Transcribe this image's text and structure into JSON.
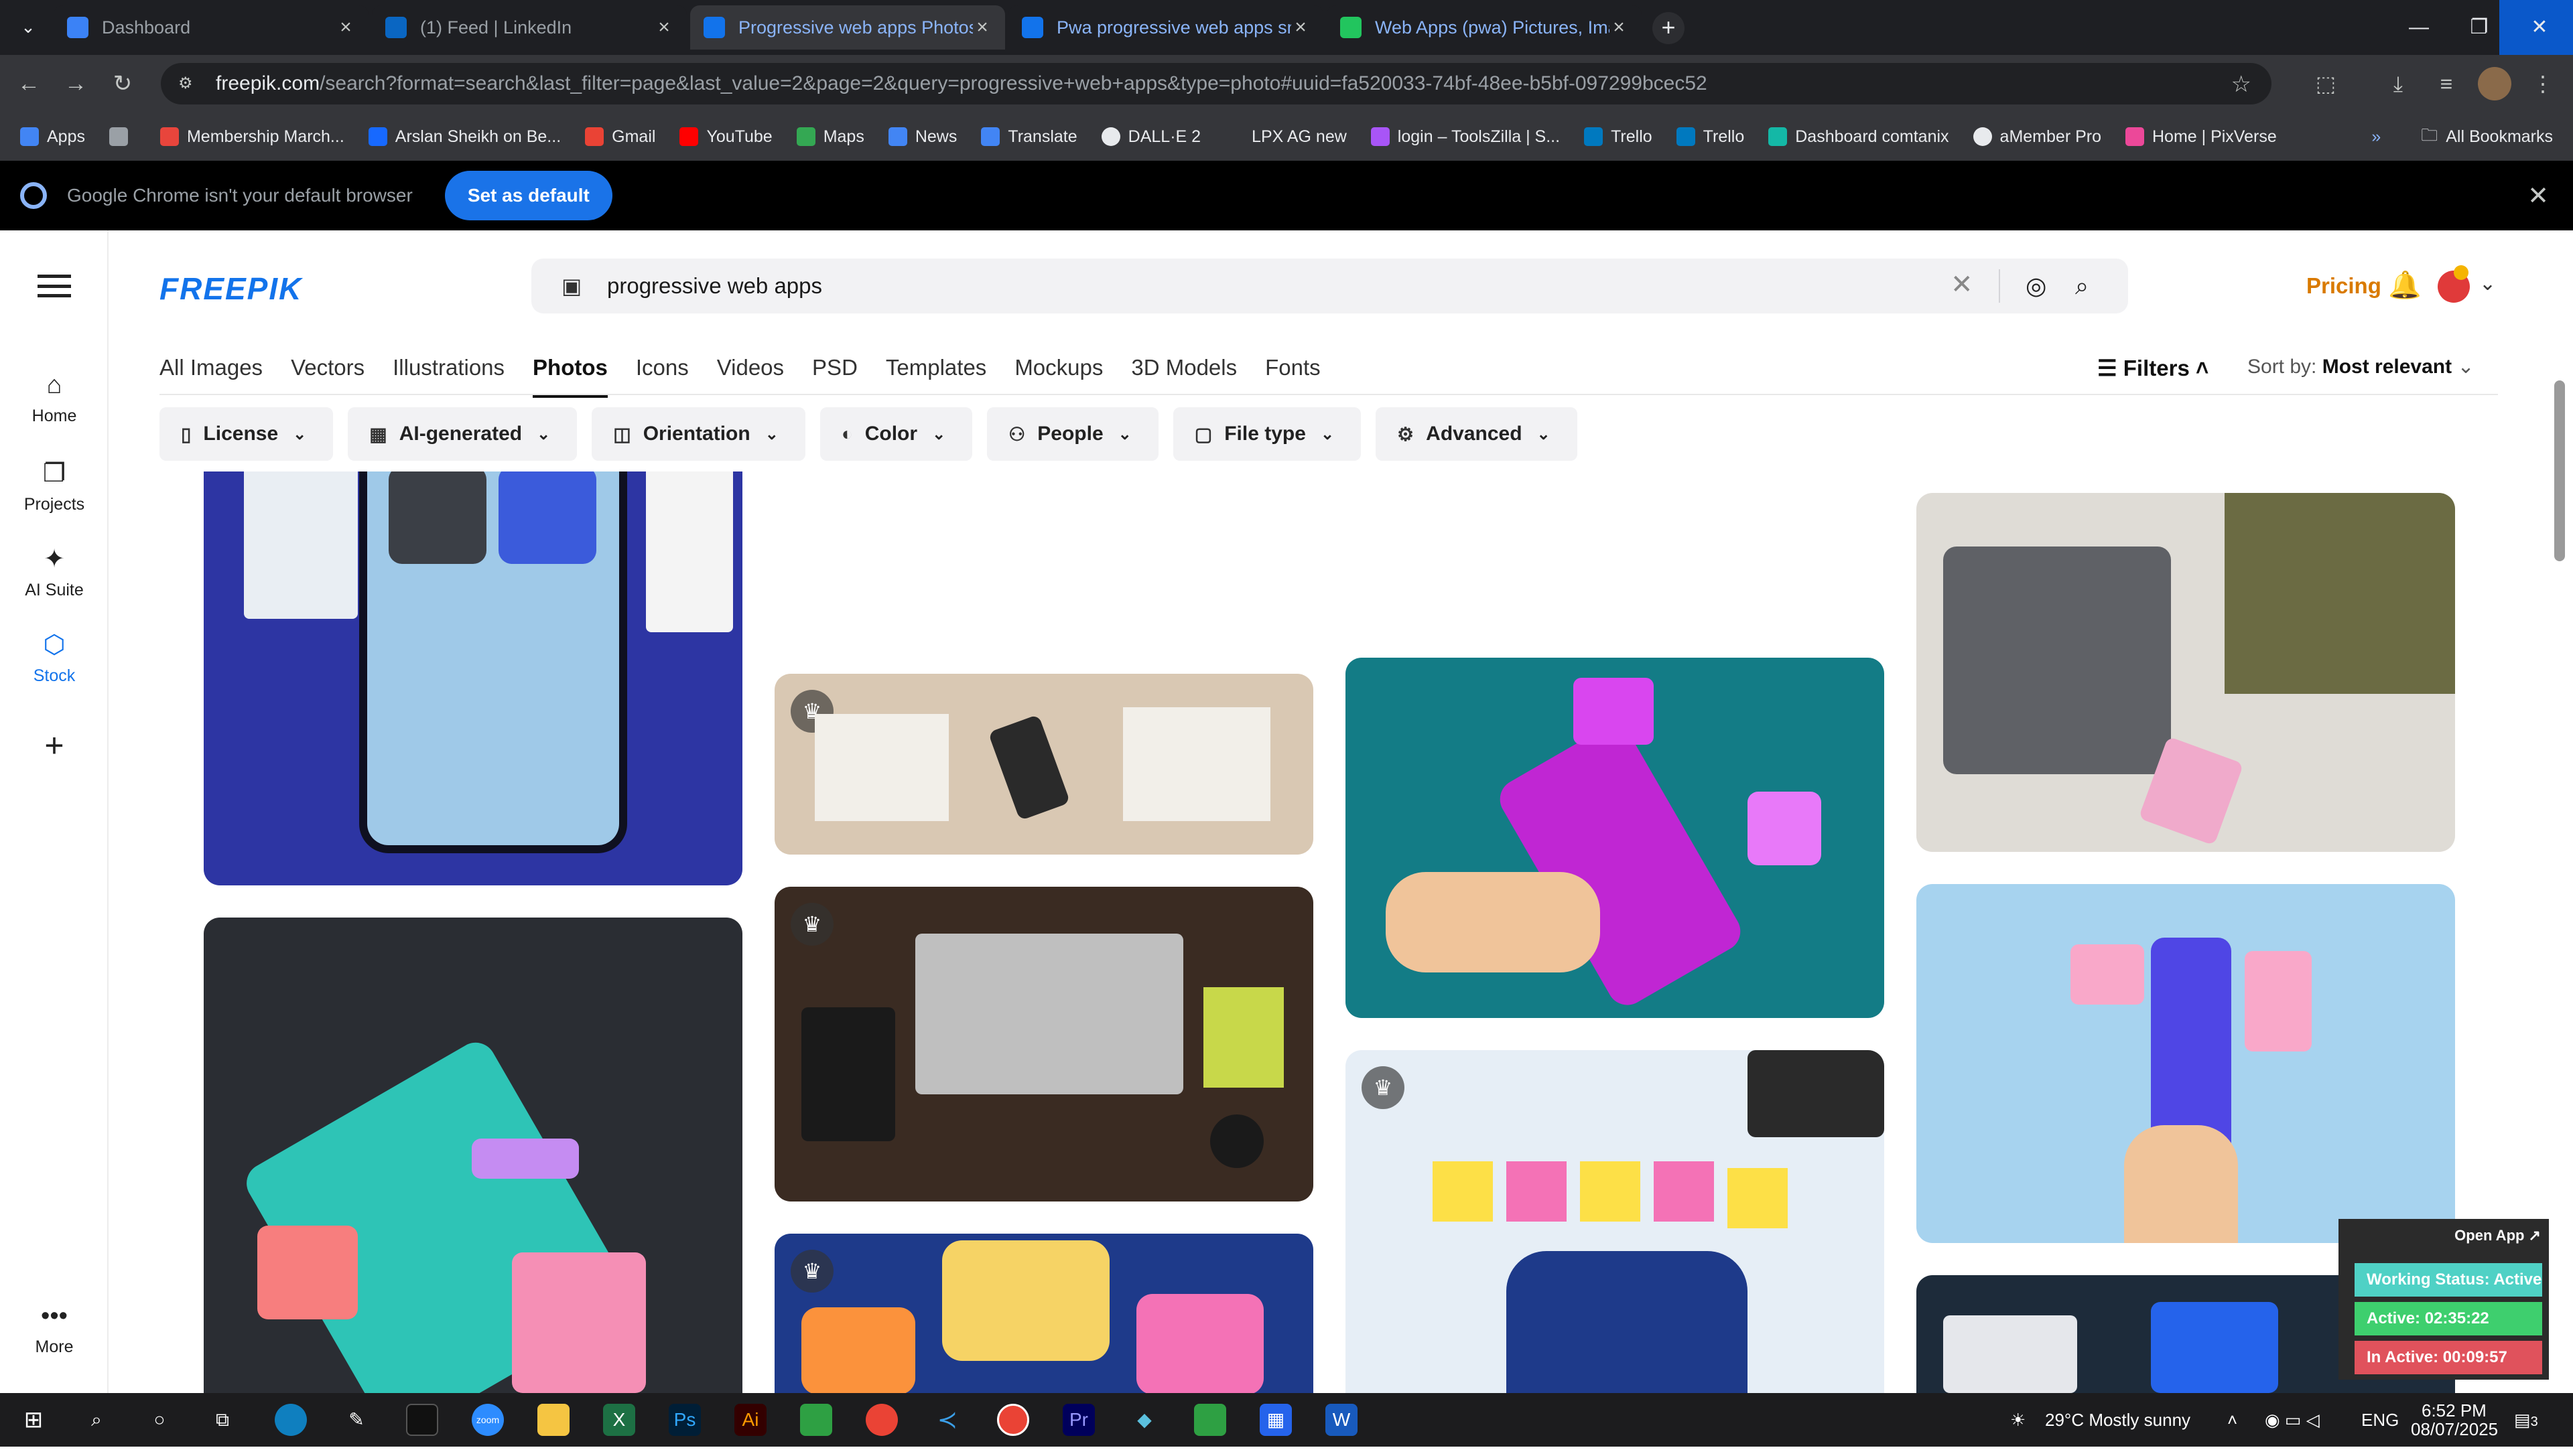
{
  "browser": {
    "tabs": [
      {
        "title": "Dashboard",
        "color": "#3b82f6"
      },
      {
        "title": "(1) Feed | LinkedIn",
        "color": "#0a66c2"
      },
      {
        "title": "Progressive web apps Photos | Fr",
        "color": "#1273eb"
      },
      {
        "title": "Pwa progressive web apps sma",
        "color": "#1273eb"
      },
      {
        "title": "Web Apps (pwa) Pictures, Imag",
        "color": "#22c55e"
      }
    ],
    "url_host": "freepik.com",
    "url_path": "/search?format=search&last_filter=page&last_value=2&page=2&query=progressive+web+apps&type=photo#uuid=fa520033-74bf-48ee-b5bf-097299bcec52",
    "bookmarks": [
      {
        "label": "Apps",
        "color": "#4285f4"
      },
      {
        "label": "",
        "color": "#9aa0a6"
      },
      {
        "label": "Membership March...",
        "color": "#e8453c"
      },
      {
        "label": "Arslan Sheikh on Be...",
        "color": "#1769ff"
      },
      {
        "label": "Gmail",
        "color": "#ea4335"
      },
      {
        "label": "YouTube",
        "color": "#ff0000"
      },
      {
        "label": "Maps",
        "color": "#34a853"
      },
      {
        "label": "News",
        "color": "#4285f4"
      },
      {
        "label": "Translate",
        "color": "#4285f4"
      },
      {
        "label": "DALL·E 2",
        "color": "#e8eaed"
      },
      {
        "label": "LPX AG new",
        "color": "#35363a"
      },
      {
        "label": "login – ToolsZilla | S...",
        "color": "#a855f7"
      },
      {
        "label": "Trello",
        "color": "#0079bf"
      },
      {
        "label": "Trello",
        "color": "#0079bf"
      },
      {
        "label": "Dashboard comtanix",
        "color": "#14b8a6"
      },
      {
        "label": "aMember Pro",
        "color": "#e8eaed"
      },
      {
        "label": "Home | PixVerse",
        "color": "#ec4899"
      }
    ],
    "all_bookmarks": "All Bookmarks",
    "infobar_message": "Google Chrome isn't your default browser",
    "infobar_button": "Set as default"
  },
  "sidebar": {
    "items": [
      {
        "label": "Home",
        "icon": "home-icon"
      },
      {
        "label": "Projects",
        "icon": "projects-icon"
      },
      {
        "label": "AI Suite",
        "icon": "ai-suite-icon"
      },
      {
        "label": "Stock",
        "icon": "stock-icon"
      },
      {
        "label": "",
        "icon": "plus-icon"
      },
      {
        "label": "More",
        "icon": "more-icon"
      }
    ]
  },
  "header": {
    "logo": "FREEPIK",
    "search_query": "progressive web apps",
    "pricing": "Pricing"
  },
  "categories": [
    "All Images",
    "Vectors",
    "Illustrations",
    "Photos",
    "Icons",
    "Videos",
    "PSD",
    "Templates",
    "Mockups",
    "3D Models",
    "Fonts"
  ],
  "active_category": "Photos",
  "filters_label": "Filters",
  "sort": {
    "label": "Sort by:",
    "value": "Most relevant"
  },
  "chips": [
    {
      "label": "License",
      "icon": "license-icon"
    },
    {
      "label": "AI-generated",
      "icon": "ai-icon"
    },
    {
      "label": "Orientation",
      "icon": "orientation-icon"
    },
    {
      "label": "Color",
      "icon": "color-icon"
    },
    {
      "label": "People",
      "icon": "people-icon"
    },
    {
      "label": "File type",
      "icon": "file-icon"
    },
    {
      "label": "Advanced",
      "icon": "advanced-icon"
    }
  ],
  "images": [
    {
      "desc": "people-with-phone-apps",
      "bg": "#2d35a3",
      "premium": false
    },
    {
      "desc": "phone-ui-ux",
      "bg": "#2a2d33",
      "premium": false
    },
    {
      "desc": "wireframe-laptop",
      "bg": "#e9e6e0",
      "premium": true
    },
    {
      "desc": "hands-wireframes",
      "bg": "#d9c8b3",
      "premium": true
    },
    {
      "desc": "laptop-apps-desk",
      "bg": "#3a2b22",
      "premium": true
    },
    {
      "desc": "app-icons-neon",
      "bg": "#1e3a8a",
      "premium": true
    },
    {
      "desc": "purple-laptop",
      "bg": "#f0ede8",
      "premium": true
    },
    {
      "desc": "phone-ui-teal",
      "bg": "#137c86",
      "premium": false
    },
    {
      "desc": "sticky-notes-phone",
      "bg": "#e6eef6",
      "premium": true
    },
    {
      "desc": "laptop-man-phone",
      "bg": "#dfdcd6",
      "premium": false
    },
    {
      "desc": "ui-ux-blue",
      "bg": "#a7d3ef",
      "premium": false
    },
    {
      "desc": "dashboard-screens",
      "bg": "#1d2b3a",
      "premium": false
    }
  ],
  "widget": {
    "open_app": "Open App ↗",
    "status": "Working Status: Active",
    "active": "Active: 02:35:22",
    "inactive": "In Active: 00:09:57"
  },
  "taskbar": {
    "weather": "29°C  Mostly sunny",
    "lang": "ENG",
    "time": "6:52 PM",
    "date": "08/07/2025",
    "notifications": "3"
  }
}
